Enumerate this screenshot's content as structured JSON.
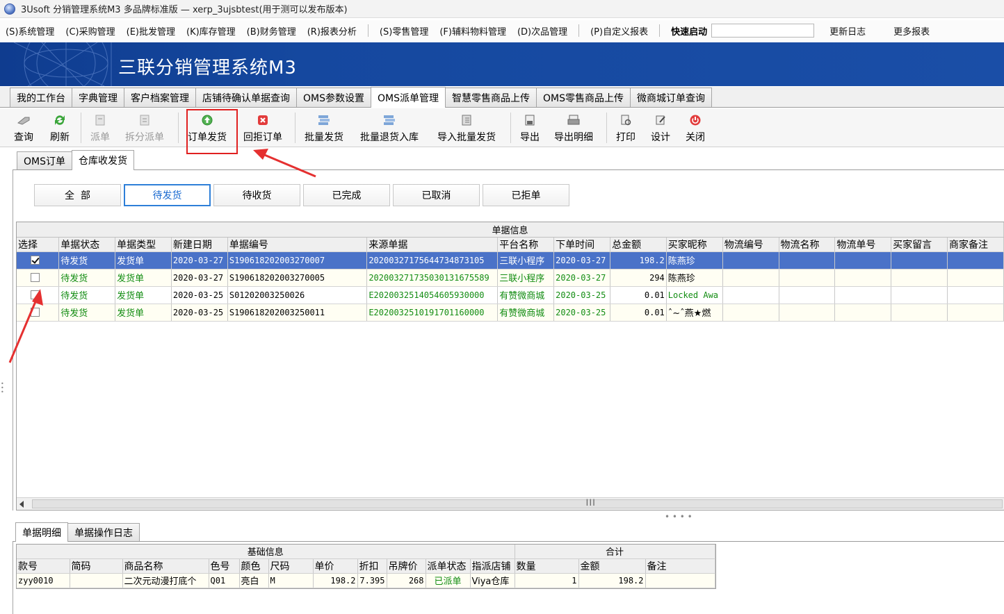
{
  "window": {
    "title": "3Usoft 分销管理系统M3 多品牌标准版 — xerp_3ujsbtest(用于测可以发布版本)"
  },
  "menu": {
    "items": [
      "(S)系统管理",
      "(C)采购管理",
      "(E)批发管理",
      "(K)库存管理",
      "(B)财务管理",
      "(R)报表分析",
      "(S)零售管理",
      "(F)辅料物料管理",
      "(D)次品管理",
      "(P)自定义报表"
    ],
    "quick_launch_label": "快速启动",
    "quick_launch_value": "",
    "update_log": "更新日志",
    "more_reports": "更多报表"
  },
  "banner": {
    "title": "三联分销管理系统M3"
  },
  "main_tabs": [
    "我的工作台",
    "字典管理",
    "客户档案管理",
    "店铺待确认单据查询",
    "OMS参数设置",
    "OMS派单管理",
    "智慧零售商品上传",
    "OMS零售商品上传",
    "微商城订单查询"
  ],
  "active_main_tab": "OMS派单管理",
  "toolbar": {
    "query": "查询",
    "refresh": "刷新",
    "dispatch": "派单",
    "split_dispatch": "拆分派单",
    "ship_order": "订单发货",
    "reject_order": "回拒订单",
    "batch_ship": "批量发货",
    "batch_return": "批量退货入库",
    "import_batch_ship": "导入批量发货",
    "export": "导出",
    "export_detail": "导出明细",
    "print": "打印",
    "design": "设计",
    "close": "关闭"
  },
  "sub_tabs": [
    "OMS订单",
    "仓库收发货"
  ],
  "filters": [
    "全  部",
    "待发货",
    "待收货",
    "已完成",
    "已取消",
    "已拒单"
  ],
  "active_filter": "待发货",
  "grid": {
    "group_header": "单据信息",
    "columns": [
      "选择",
      "单据状态",
      "单据类型",
      "新建日期",
      "单据编号",
      "来源单据",
      "平台名称",
      "下单时间",
      "总金额",
      "买家昵称",
      "物流编号",
      "物流名称",
      "物流单号",
      "买家留言",
      "商家备注"
    ],
    "rows": [
      {
        "checked": true,
        "status": "待发货",
        "type": "发货单",
        "date": "2020-03-27",
        "number": "S190618202003270007",
        "source": "20200327175644734873105⁢",
        "platform": "三联小程序",
        "order_time": "2020-03-27",
        "amount": "198.2",
        "buyer": "陈燕珍"
      },
      {
        "checked": false,
        "status": "待发货",
        "type": "发货单",
        "date": "2020-03-27",
        "number": "S190618202003270005",
        "source": "202003271735030131675589",
        "platform": "三联小程序",
        "order_time": "2020-03-27",
        "amount": "294",
        "buyer": "陈燕珍"
      },
      {
        "checked": false,
        "status": "待发货",
        "type": "发货单",
        "date": "2020-03-25",
        "number": "S01202003250026",
        "source": "E2020032514054605930000⁢",
        "platform": "有赞微商城",
        "order_time": "2020-03-25",
        "amount": "0.01",
        "buyer": "Locked Awa"
      },
      {
        "checked": false,
        "status": "待发货",
        "type": "发货单",
        "date": "2020-03-25",
        "number": "S190618202003250011",
        "source": "E2020032510191701160000⁢",
        "platform": "有赞微商城",
        "order_time": "2020-03-25",
        "amount": "0.01",
        "buyer": "ˆ~ˆ燕★燃"
      }
    ]
  },
  "bottom_tabs": [
    "单据明细",
    "单据操作日志"
  ],
  "detail": {
    "group_basic": "基础信息",
    "group_total": "合计",
    "columns": [
      "款号",
      "简码",
      "商品名称",
      "色号",
      "颜色",
      "尺码",
      "单价",
      "折扣",
      "吊牌价",
      "派单状态",
      "指派店铺",
      "数量",
      "金额",
      "备注"
    ],
    "rows": [
      {
        "code": "zyy0010",
        "short": "",
        "name": "二次元动漫打底个",
        "color_no": "Q01",
        "color": "亮白",
        "size": "M",
        "price": "198.2",
        "discount": "7.395",
        "tag_price": "268",
        "dispatch_status": "已派单",
        "store": "Viya仓库",
        "qty": "1",
        "amount": "198.2",
        "remark": ""
      }
    ]
  }
}
